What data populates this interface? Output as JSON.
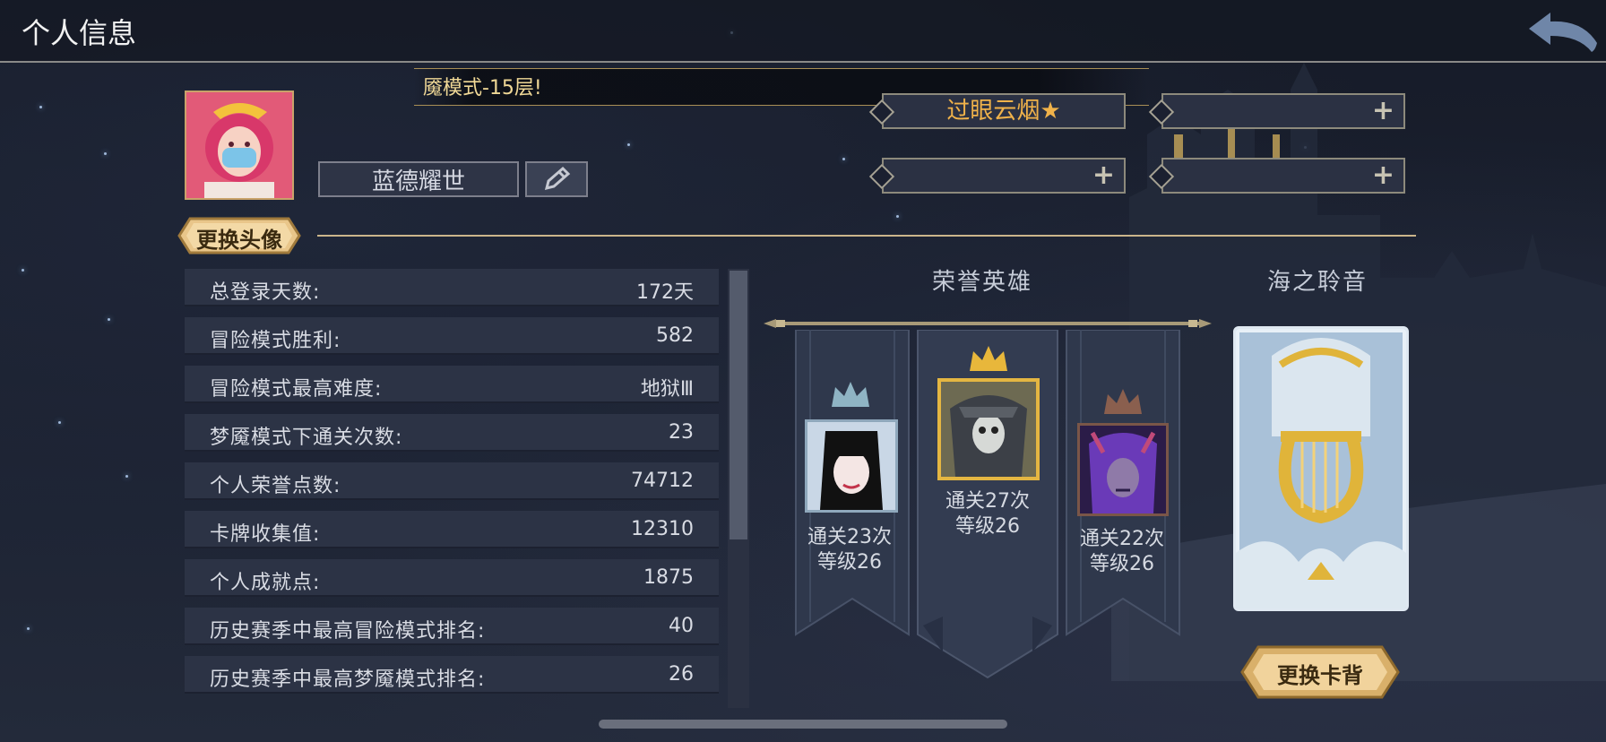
{
  "header": {
    "title": "个人信息",
    "back_icon": "back-arrow-icon"
  },
  "profile": {
    "tip_text": "魇模式-15层!",
    "player_name": "蓝德耀世",
    "edit_icon": "pencil-icon",
    "change_avatar_label": "更换头像",
    "titles": [
      {
        "text": "过眼云烟★",
        "empty": false
      },
      {
        "text": "",
        "empty": true
      },
      {
        "text": "",
        "empty": true
      },
      {
        "text": "",
        "empty": true
      }
    ],
    "add_icon": "plus-icon"
  },
  "stats": [
    {
      "label": "总登录天数:",
      "value": "172天"
    },
    {
      "label": "冒险模式胜利:",
      "value": "582"
    },
    {
      "label": "冒险模式最高难度:",
      "value": "地狱Ⅲ"
    },
    {
      "label": "梦魇模式下通关次数:",
      "value": "23"
    },
    {
      "label": "个人荣誉点数:",
      "value": "74712"
    },
    {
      "label": "卡牌收集值:",
      "value": "12310"
    },
    {
      "label": "个人成就点:",
      "value": "1875"
    },
    {
      "label": "历史赛季中最高冒险模式排名:",
      "value": "40"
    },
    {
      "label": "历史赛季中最高梦魇模式排名:",
      "value": "26"
    }
  ],
  "honor": {
    "title": "荣誉英雄",
    "heroes": [
      {
        "clears": "通关23次",
        "level": "等级26",
        "crown": "silver"
      },
      {
        "clears": "通关27次",
        "level": "等级26",
        "crown": "gold"
      },
      {
        "clears": "通关22次",
        "level": "等级26",
        "crown": "bronze"
      }
    ]
  },
  "card_back": {
    "title": "海之聆音",
    "change_label": "更换卡背"
  },
  "colors": {
    "gold_text": "#f0b24a",
    "accent_gold": "#cbb58b",
    "panel": "#2c3345"
  }
}
